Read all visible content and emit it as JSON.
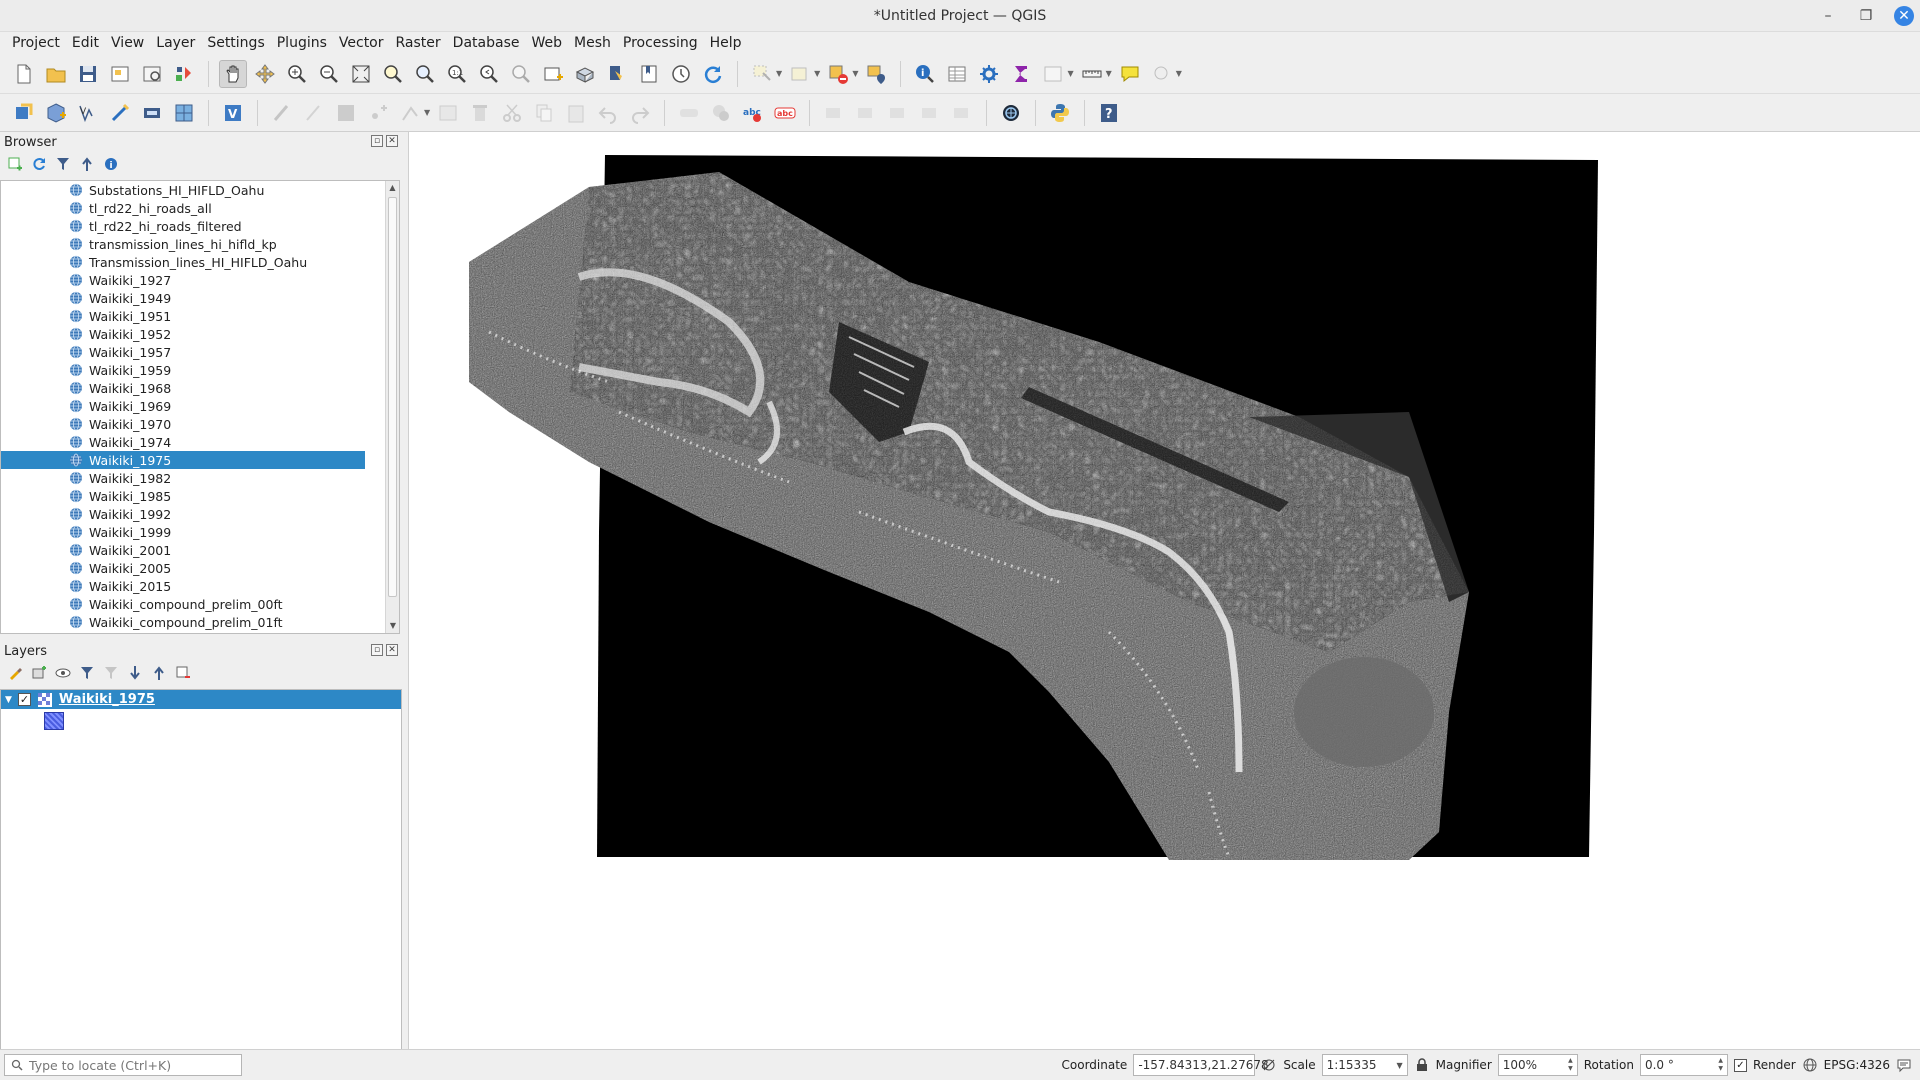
{
  "window": {
    "title": "*Untitled Project — QGIS"
  },
  "menu": [
    "Project",
    "Edit",
    "View",
    "Layer",
    "Settings",
    "Plugins",
    "Vector",
    "Raster",
    "Database",
    "Web",
    "Mesh",
    "Processing",
    "Help"
  ],
  "browser": {
    "title": "Browser",
    "items": [
      "Substations_HI_HIFLD_Oahu",
      "tl_rd22_hi_roads_all",
      "tl_rd22_hi_roads_filtered",
      "transmission_lines_hi_hifld_kp",
      "Transmission_lines_HI_HIFLD_Oahu",
      "Waikiki_1927",
      "Waikiki_1949",
      "Waikiki_1951",
      "Waikiki_1952",
      "Waikiki_1957",
      "Waikiki_1959",
      "Waikiki_1968",
      "Waikiki_1969",
      "Waikiki_1970",
      "Waikiki_1974",
      "Waikiki_1975",
      "Waikiki_1982",
      "Waikiki_1985",
      "Waikiki_1992",
      "Waikiki_1999",
      "Waikiki_2001",
      "Waikiki_2005",
      "Waikiki_2015",
      "Waikiki_compound_prelim_00ft",
      "Waikiki_compound_prelim_01ft"
    ],
    "selected_index": 15
  },
  "layers": {
    "title": "Layers",
    "items": [
      {
        "name": "Waikiki_1975",
        "checked": true
      }
    ]
  },
  "status": {
    "locator_placeholder": "Type to locate (Ctrl+K)",
    "coordinate_label": "Coordinate",
    "coordinate_value": "-157.84313,21.27678",
    "scale_label": "Scale",
    "scale_value": "1:15335",
    "magnifier_label": "Magnifier",
    "magnifier_value": "100%",
    "rotation_label": "Rotation",
    "rotation_value": "0.0 °",
    "render_label": "Render",
    "render_checked": true,
    "crs": "EPSG:4326"
  },
  "colors": {
    "selection": "#2d88c6",
    "close_button": "#3584e4"
  }
}
